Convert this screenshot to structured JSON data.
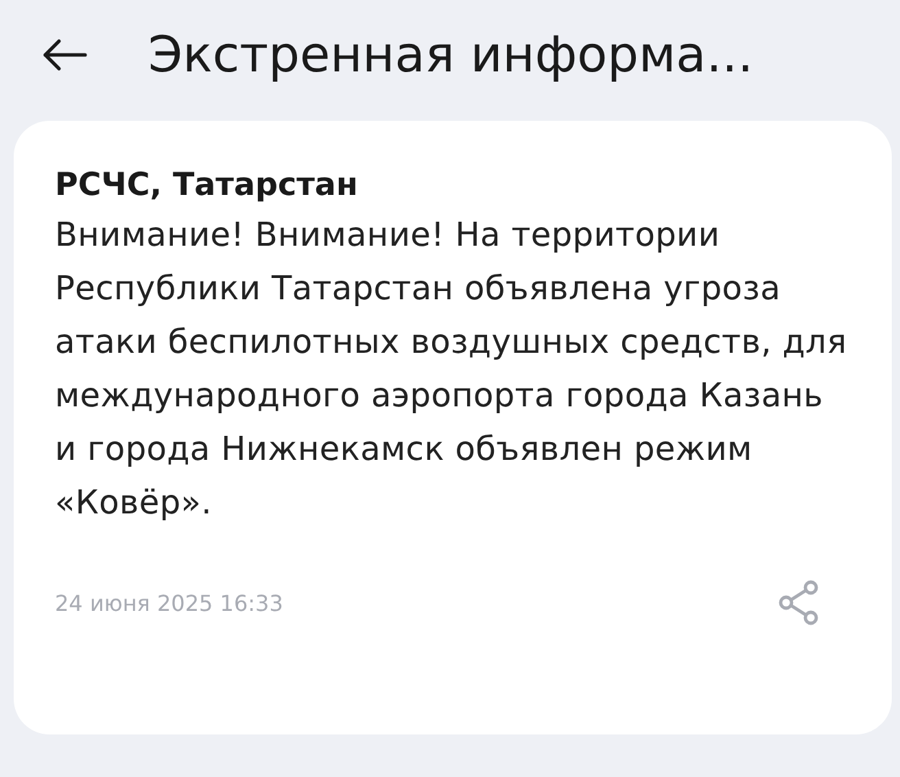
{
  "header": {
    "title": "Экстренная информа..."
  },
  "message": {
    "source": "РСЧС, Татарстан",
    "text": "Внимание! Внимание! На территории Республики Татарстан объявлена угроза атаки беспилотных воздушных средств, для международного аэропорта города Казань и города Нижнекамск объявлен режим «Ковёр».",
    "date": "24 июня 2025 16:33"
  }
}
